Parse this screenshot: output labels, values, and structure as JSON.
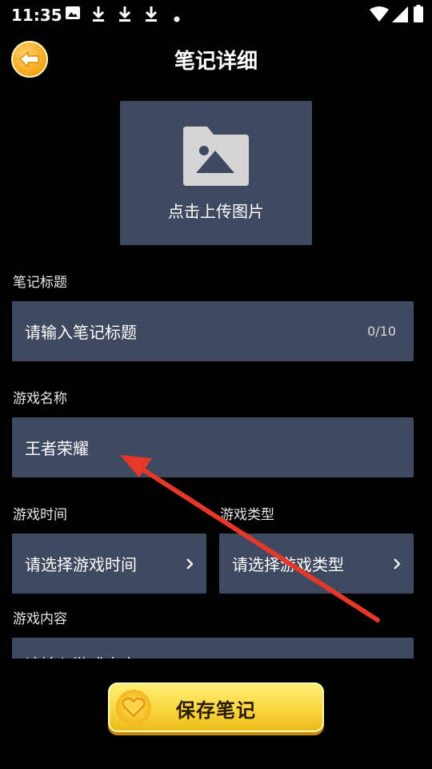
{
  "status_bar": {
    "time": "11:35",
    "icons": [
      "image-icon",
      "download-icon",
      "download-icon",
      "download-icon",
      "dot-icon",
      "wifi-icon",
      "signal-icon",
      "battery-icon"
    ]
  },
  "header": {
    "title": "笔记详细",
    "back_icon": "back-arrow-icon"
  },
  "upload": {
    "label": "点击上传图片",
    "icon": "image-placeholder-icon"
  },
  "form": {
    "title_label": "笔记标题",
    "title_placeholder": "请输入笔记标题",
    "title_counter": "0/10",
    "game_name_label": "游戏名称",
    "game_name_value": "王者荣耀",
    "game_time_label": "游戏时间",
    "game_time_placeholder": "请选择游戏时间",
    "game_type_label": "游戏类型",
    "game_type_placeholder": "请选择游戏类型",
    "content_label": "游戏内容",
    "content_placeholder": "请输入游戏内容"
  },
  "save_button": {
    "label": "保存笔记",
    "icon": "heart-icon"
  },
  "colors": {
    "background": "#000000",
    "field": "#3f4a61",
    "accent_yellow": "#f7d43a",
    "annotation_arrow": "#e5382a"
  }
}
